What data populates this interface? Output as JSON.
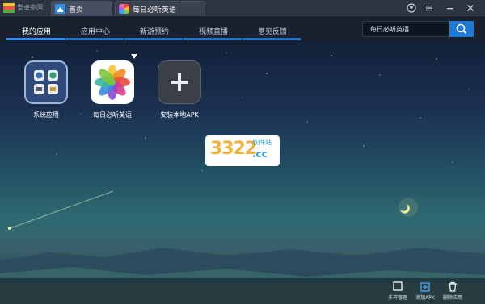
{
  "titlebar": {
    "app_name": "安卓中国",
    "tabs": [
      {
        "label": "首页",
        "icon": "home-icon",
        "active": true
      },
      {
        "label": "每日必听英语",
        "icon": "app-tab-icon",
        "active": false
      }
    ],
    "window_controls": [
      "user-icon",
      "menu-icon",
      "minimize-icon",
      "close-icon"
    ]
  },
  "nav": {
    "items": [
      {
        "label": "我的应用",
        "active": true
      },
      {
        "label": "应用中心",
        "active": false
      },
      {
        "label": "新游预约",
        "active": false
      },
      {
        "label": "视频直播",
        "active": false
      },
      {
        "label": "意见反馈",
        "active": false
      }
    ],
    "search_value": "每日必听英语"
  },
  "apps": [
    {
      "label": "系统应用",
      "icon": "system-apps-icon"
    },
    {
      "label": "每日必听英语",
      "icon": "photos-flower-icon"
    },
    {
      "label": "安装本地APK",
      "icon": "plus-icon"
    }
  ],
  "watermark": {
    "digits": "3322",
    "suffix": ".cc",
    "sub": "软件站"
  },
  "toolbar": [
    {
      "label": "多开管理",
      "icon": "multi-window-icon"
    },
    {
      "label": "添加APK",
      "icon": "add-apk-icon"
    },
    {
      "label": "删除应用",
      "icon": "trash-icon"
    }
  ],
  "colors": {
    "accent": "#2f8cf0",
    "titlebar": "#2d3440",
    "navbar": "#17202c"
  }
}
